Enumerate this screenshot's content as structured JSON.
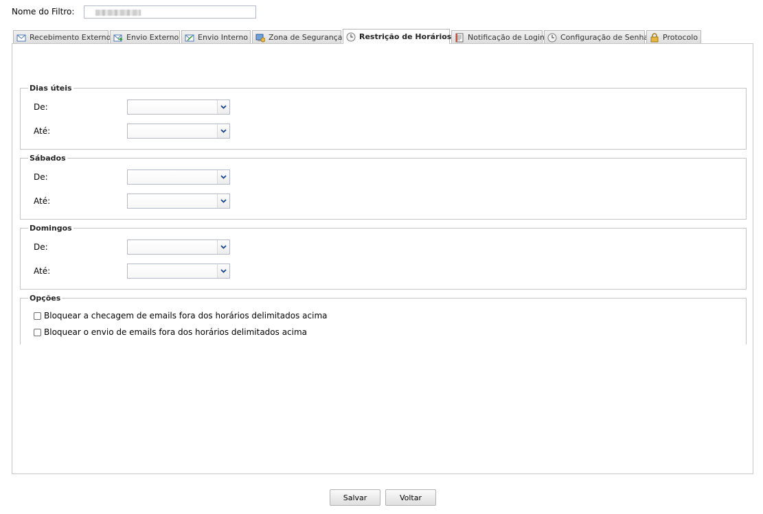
{
  "filter": {
    "label": "Nome do Filtro:",
    "value": ""
  },
  "tabs": [
    {
      "label": "Recebimento Externo",
      "icon": "mail-in-icon"
    },
    {
      "label": "Envio Externo",
      "icon": "mail-out-icon"
    },
    {
      "label": "Envio Interno",
      "icon": "mail-internal-icon"
    },
    {
      "label": "Zona de Segurança",
      "icon": "security-zone-icon"
    },
    {
      "label": "Restrição de Horários",
      "icon": "clock-icon",
      "active": true
    },
    {
      "label": "Notificação de Login",
      "icon": "notification-icon"
    },
    {
      "label": "Configuração de Senha",
      "icon": "clock-icon"
    },
    {
      "label": "Protocolo",
      "icon": "lock-icon"
    }
  ],
  "sections": {
    "weekdays": {
      "legend": "Dias úteis",
      "from_label": "De:",
      "to_label": "Até:",
      "from_value": "",
      "to_value": ""
    },
    "saturdays": {
      "legend": "Sábados",
      "from_label": "De:",
      "to_label": "Até:",
      "from_value": "",
      "to_value": ""
    },
    "sundays": {
      "legend": "Domingos",
      "from_label": "De:",
      "to_label": "Até:",
      "from_value": "",
      "to_value": ""
    }
  },
  "options": {
    "legend": "Opções",
    "block_check_label": "Bloquear a checagem de emails fora dos horários delimitados acima",
    "block_send_label": "Bloquear o envio de emails fora dos horários delimitados acima",
    "block_check_checked": false,
    "block_send_checked": false
  },
  "buttons": {
    "save": "Salvar",
    "back": "Voltar"
  },
  "colors": {
    "tab_border": "#b6b6b6",
    "trigger_arrow": "#15428b",
    "field_border": "#b5b8c8"
  }
}
